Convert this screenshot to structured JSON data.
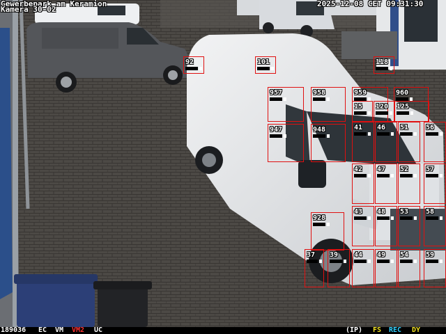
{
  "osd": {
    "site": "Gewerbepark am Keramion",
    "camera": "Kamera 30-02",
    "datetime": "2025-12-08 CET 09:31:30"
  },
  "status": {
    "frame": "189036",
    "flag1": "EC",
    "flag2": "VM",
    "flag3": "VM2",
    "flag4": "UC",
    "ip": "(IP)",
    "fs": "FS",
    "rec": "REC",
    "dy": "DY"
  },
  "colors": {
    "zone": "#e01010",
    "vm2": "#ff3030",
    "fs": "#f0e020",
    "rec": "#30d0ff",
    "dy": "#f0e020"
  },
  "zones": [
    "92",
    "101",
    "118",
    "957",
    "958",
    "959",
    "960",
    "15",
    "120",
    "125",
    "947",
    "948",
    "41",
    "46",
    "51",
    "56",
    "42",
    "47",
    "52",
    "57",
    "43",
    "48",
    "53",
    "58",
    "928",
    "37",
    "39",
    "44",
    "49",
    "54",
    "59"
  ]
}
